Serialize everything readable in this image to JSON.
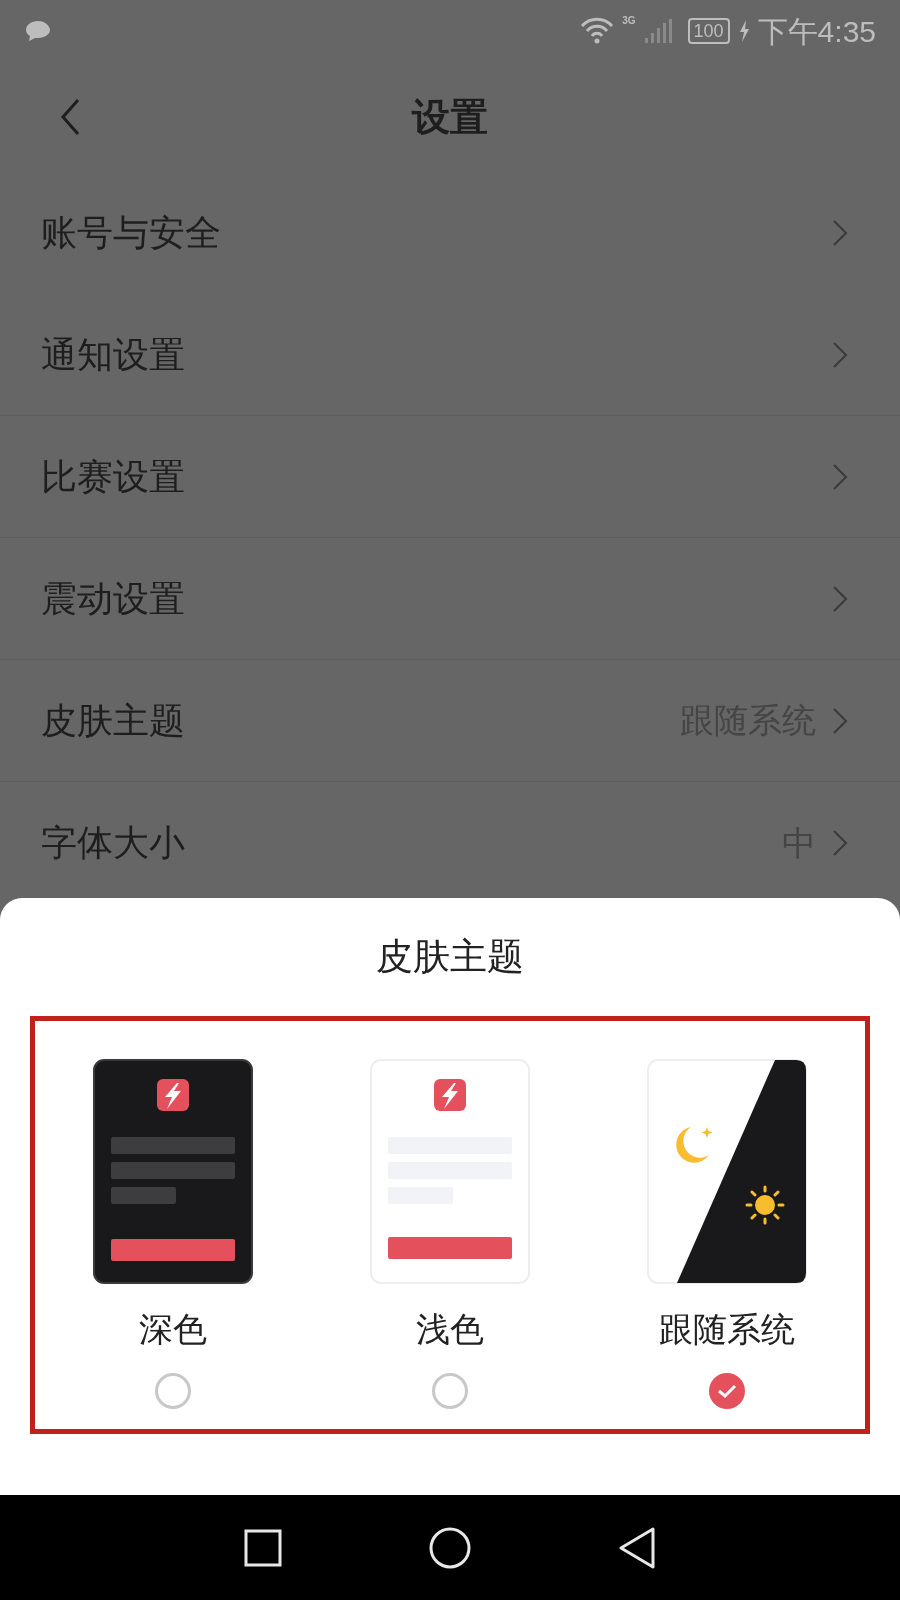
{
  "status_bar": {
    "network": "3G",
    "battery": "100",
    "time": "下午4:35"
  },
  "header": {
    "title": "设置"
  },
  "sections": [
    {
      "items": [
        {
          "label": "账号与安全"
        }
      ]
    },
    {
      "items": [
        {
          "label": "通知设置"
        },
        {
          "label": "比赛设置"
        },
        {
          "label": "震动设置"
        },
        {
          "label": "皮肤主题",
          "value": "跟随系统"
        },
        {
          "label": "字体大小",
          "value": "中"
        }
      ]
    }
  ],
  "theme_sheet": {
    "title": "皮肤主题",
    "options": [
      {
        "kind": "dark",
        "label": "深色",
        "selected": false
      },
      {
        "kind": "light",
        "label": "浅色",
        "selected": false
      },
      {
        "kind": "system",
        "label": "跟随系统",
        "selected": true
      }
    ]
  }
}
